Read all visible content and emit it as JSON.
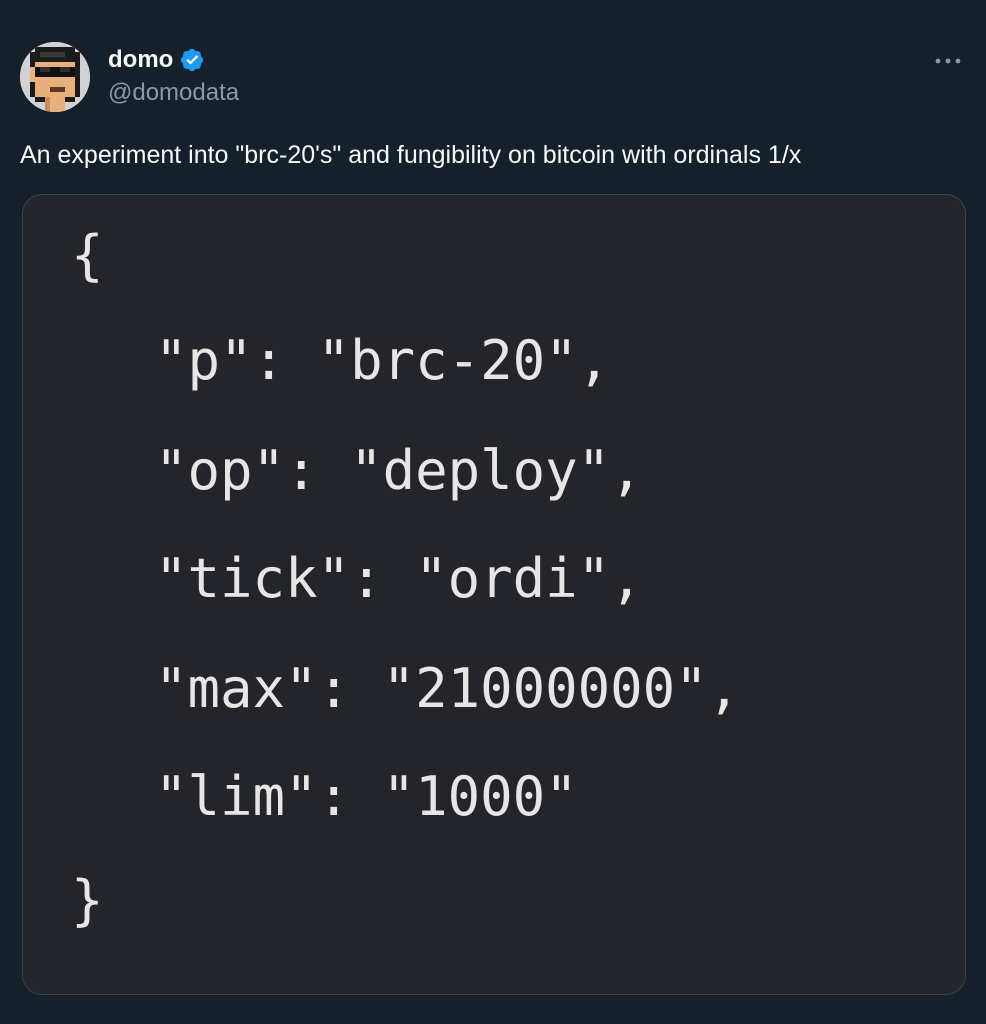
{
  "author": {
    "display_name": "domo",
    "handle": "@domodata",
    "verified": true,
    "avatar_icon": "pixel-punk-avatar-icon",
    "verified_icon": "verified-badge-icon",
    "verified_color": "#1d9bf0"
  },
  "more_icon": "more-horizontal-icon",
  "tweet": {
    "text": "An experiment into \"brc-20's\" and fungibility on bitcoin with ordinals 1/x"
  },
  "media": {
    "code_lines": [
      "{",
      "\"p\": \"brc-20\",",
      "\"op\": \"deploy\",",
      "\"tick\": \"ordi\",",
      "\"max\": \"21000000\",",
      "\"lim\": \"1000\"",
      "}"
    ]
  },
  "colors": {
    "background": "#15202b",
    "text": "#f7f9f9",
    "secondary_text": "#8b98a5",
    "code_background": "#23252a",
    "code_text": "#e6e6e6"
  }
}
